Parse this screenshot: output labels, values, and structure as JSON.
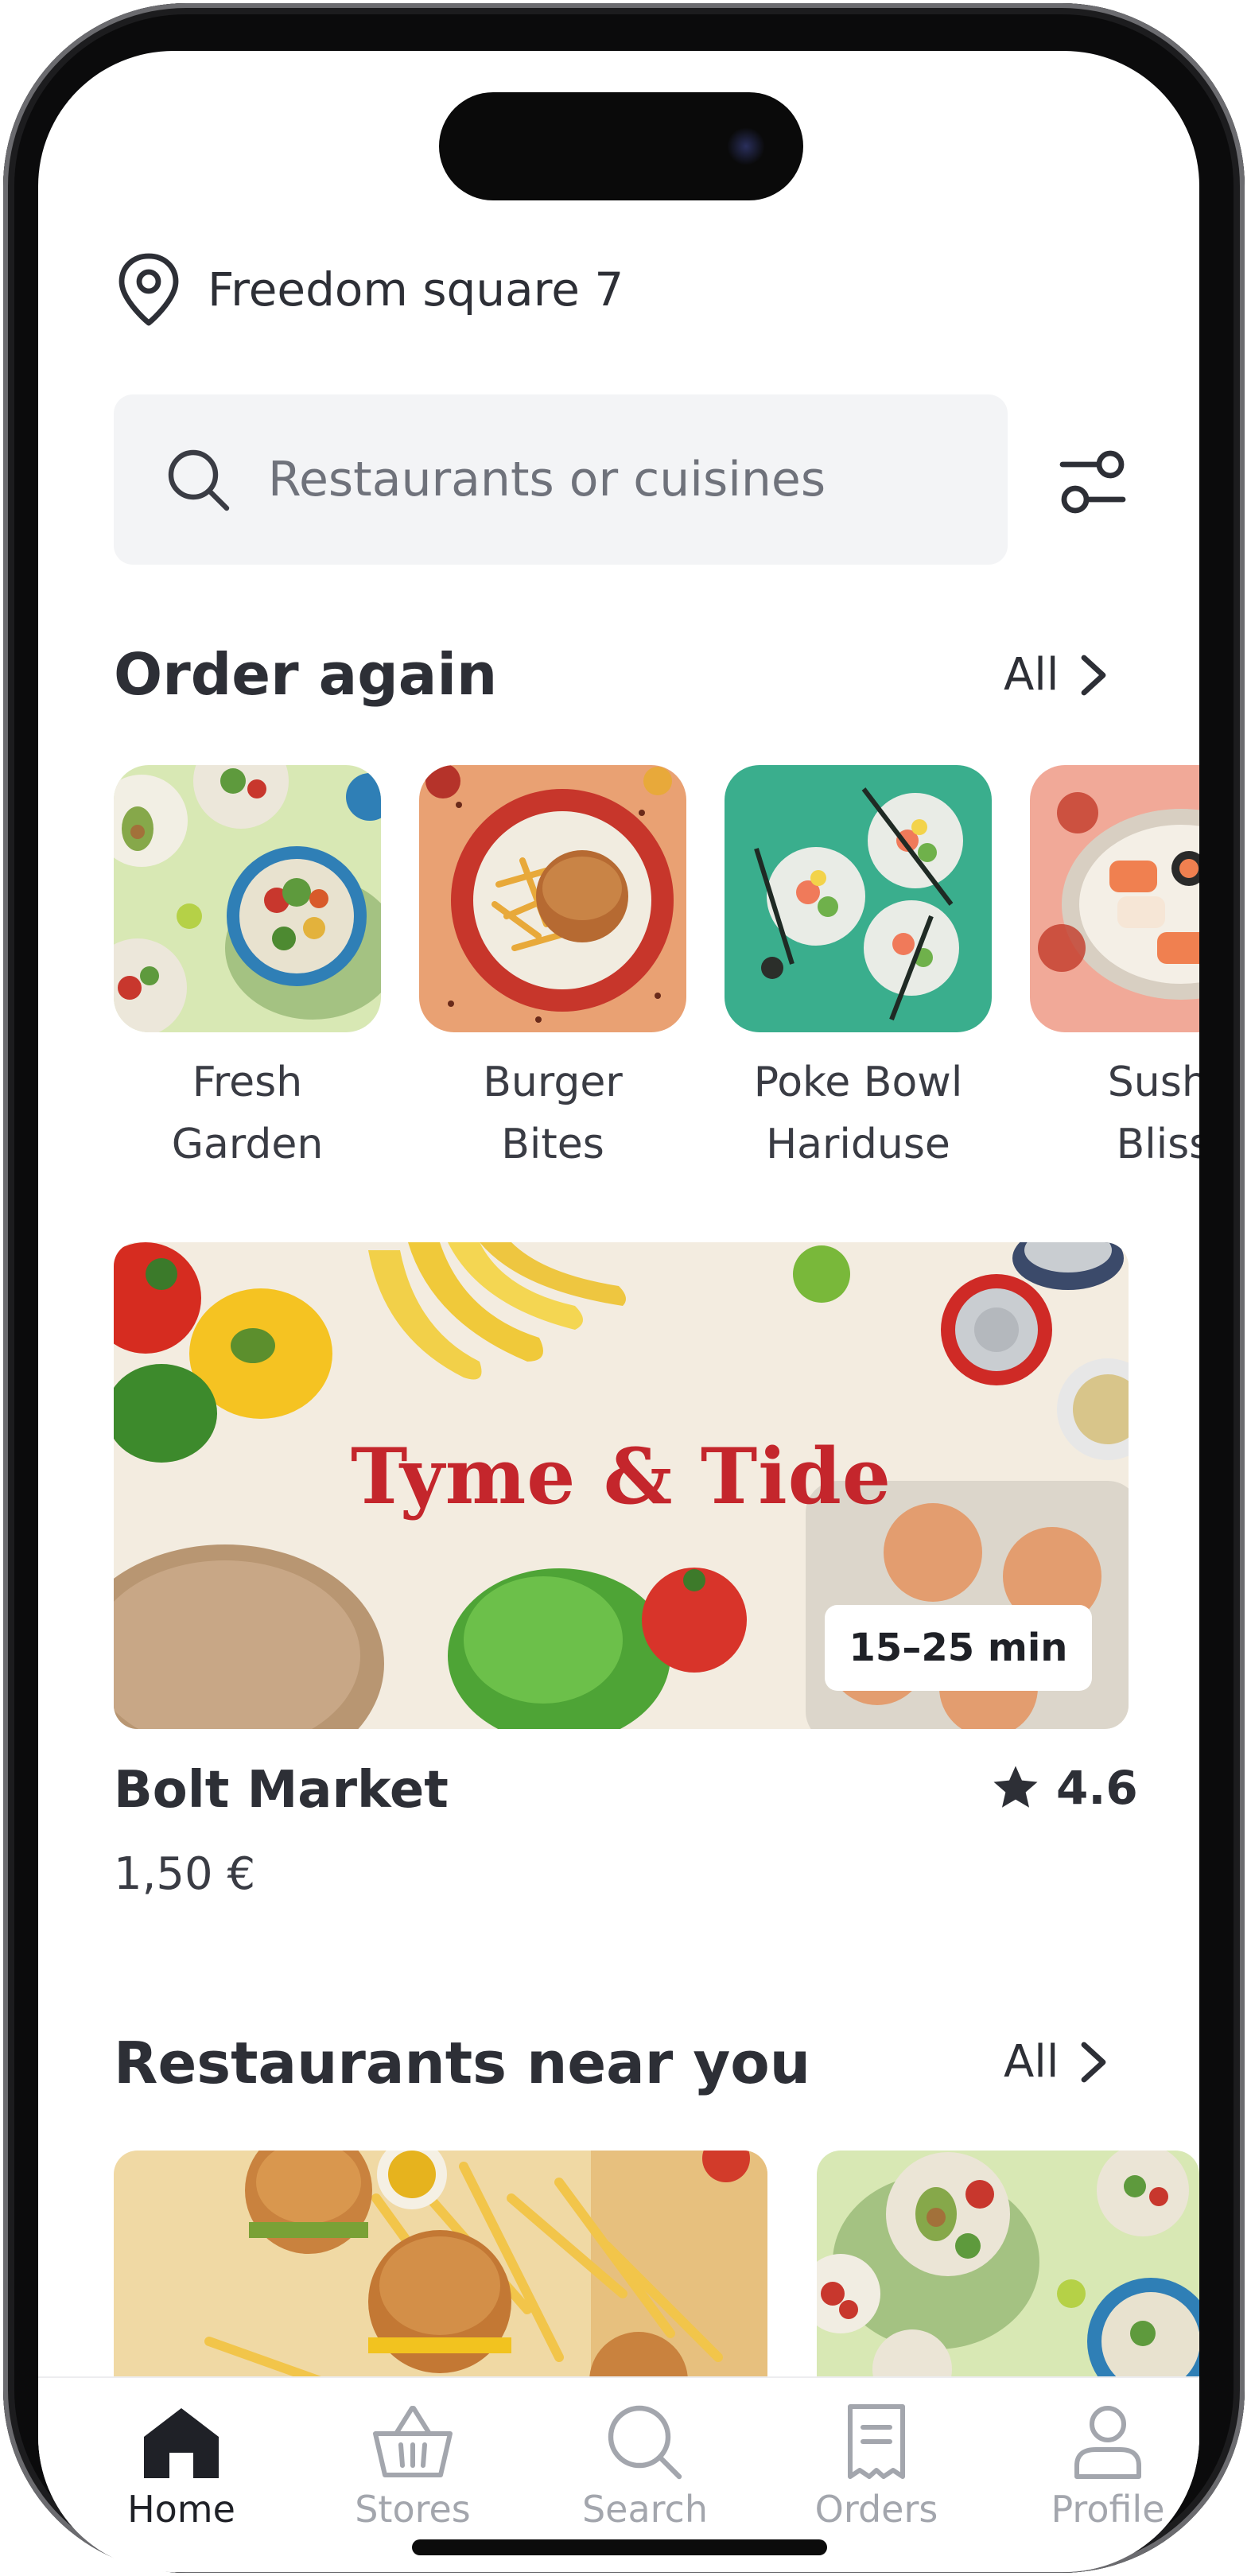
{
  "location": {
    "address": "Freedom square 7"
  },
  "search": {
    "placeholder": "Restaurants or cuisines"
  },
  "order_again": {
    "title": "Order again",
    "all_label": "All",
    "items": [
      {
        "label": "Fresh\nGarden"
      },
      {
        "label": "Burger\nBites"
      },
      {
        "label": "Poke Bowl\nHariduse"
      },
      {
        "label": "Sushi\nBliss"
      }
    ]
  },
  "promo": {
    "brand": "Tyme & Tide",
    "eta": "15–25 min",
    "store_name": "Bolt Market",
    "delivery_fee": "1,50 €",
    "rating": "4.6"
  },
  "restaurants": {
    "title": "Restaurants near you",
    "all_label": "All"
  },
  "nav": {
    "items": [
      {
        "label": "Home"
      },
      {
        "label": "Stores"
      },
      {
        "label": "Search"
      },
      {
        "label": "Orders"
      },
      {
        "label": "Profile"
      }
    ]
  },
  "colors": {
    "text_primary": "#2d2f36",
    "text_secondary": "#6f727b",
    "nav_active": "#1f2127",
    "nav_inactive": "#a3a6ad",
    "brand_red": "#c4262c",
    "search_bg": "#f3f4f6"
  }
}
